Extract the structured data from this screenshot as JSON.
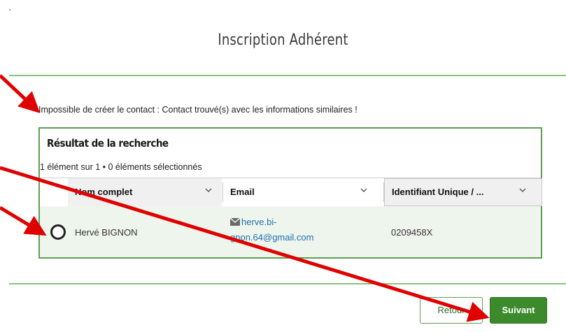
{
  "page": {
    "title": "Inscription Adhérent"
  },
  "notice": "Impossible de créer le contact : Contact trouvé(s) avec les informations similaires !",
  "results": {
    "title": "Résultat de la recherche",
    "count_text": "1 élément sur 1 • 0 éléments sélectionnés",
    "columns": [
      "Nom complet",
      "Email",
      "Identifiant Unique / ..."
    ],
    "rows": [
      {
        "name": "Hervé BIGNON",
        "email_line1": "herve.bi-",
        "email_line2": "gnon.64@gmail.com",
        "id": "0209458X"
      }
    ]
  },
  "buttons": {
    "back": "Retour",
    "next": "Suivant"
  },
  "icons": {
    "mail": "mail-icon",
    "chevron": "chevron-down-icon",
    "radio": "radio-button"
  },
  "colors": {
    "accent_green": "#3c8a2c",
    "border_green": "#5f9d55",
    "annotation_red": "#e00000",
    "link_blue": "#1f6fb0"
  }
}
